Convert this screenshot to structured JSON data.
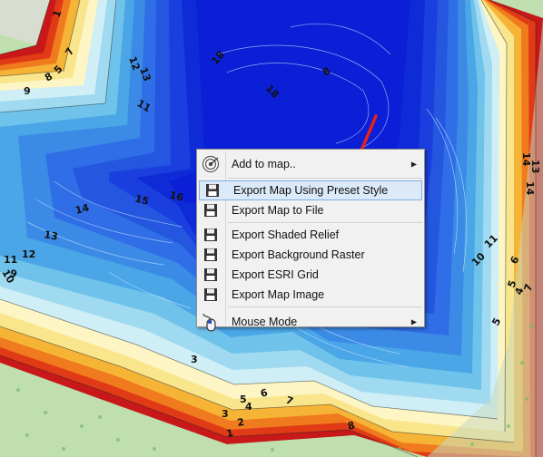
{
  "map": {
    "contour_labels": [
      "1",
      "7",
      "5",
      "8",
      "9",
      "12",
      "13",
      "11",
      "15",
      "16",
      "14",
      "13",
      "12",
      "11",
      "10",
      "9",
      "10",
      "11",
      "14",
      "13",
      "14",
      "6",
      "5",
      "4",
      "7",
      "5",
      "3",
      "1",
      "2",
      "6",
      "5",
      "4",
      "3",
      "8",
      "7",
      "18",
      "18",
      "8"
    ]
  },
  "context_menu": {
    "items": [
      {
        "label": "Add to map..",
        "icon": "target-icon",
        "has_submenu": true
      },
      {
        "label": "Export Map Using Preset Style",
        "icon": "floppy-disk-icon",
        "highlighted": true
      },
      {
        "label": "Export Map to File",
        "icon": "floppy-disk-icon"
      },
      {
        "label": "Export Shaded Relief",
        "icon": "floppy-disk-icon"
      },
      {
        "label": "Export Background Raster",
        "icon": "floppy-disk-icon"
      },
      {
        "label": "Export ESRI Grid",
        "icon": "floppy-disk-icon"
      },
      {
        "label": "Export Map Image",
        "icon": "floppy-disk-icon"
      },
      {
        "label": "Mouse Mode",
        "icon": "mouse-icon",
        "has_submenu": true
      }
    ]
  },
  "colors": {
    "annotation_arrow": "#e8211a",
    "menu_highlight": "#dbe9f8",
    "deep_water": "#0a1fd6",
    "land": "#b9dca8"
  }
}
